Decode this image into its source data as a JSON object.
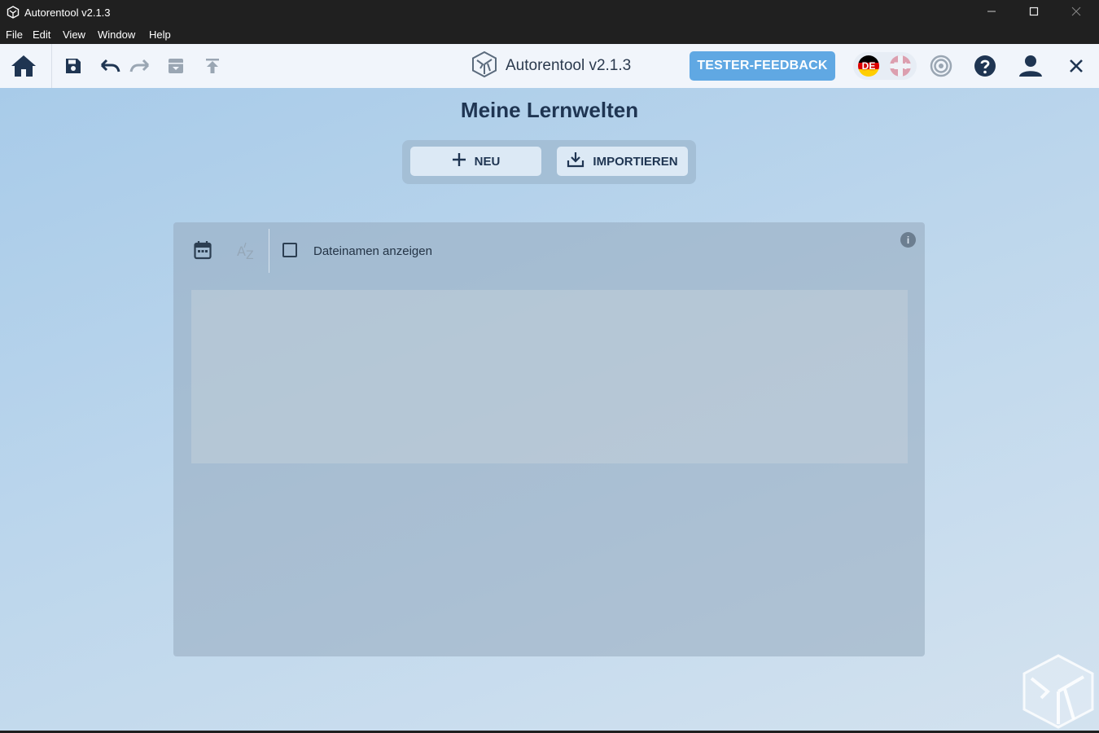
{
  "window": {
    "title": "Autorentool v2.1.3",
    "controls": [
      "minimize-icon",
      "maximize-icon",
      "close-icon"
    ]
  },
  "menu": {
    "items": [
      {
        "label": "File"
      },
      {
        "label": "Edit"
      },
      {
        "label": "View"
      },
      {
        "label": "Window"
      },
      {
        "label": "Help"
      }
    ]
  },
  "toolbar": {
    "left_icons": [
      "home-icon",
      "save-icon",
      "undo-icon",
      "redo-icon",
      "archive-icon",
      "upload-icon"
    ],
    "brand_name": "Autorentool v2.1.3",
    "feedback_label": "TESTER-FEEDBACK",
    "languages": [
      {
        "code": "DE",
        "active": true
      },
      {
        "code": "EN",
        "active": false
      }
    ],
    "right_icons": [
      "target-icon",
      "help-icon",
      "user-icon",
      "close-icon"
    ]
  },
  "main": {
    "heading": "Meine Lernwelten",
    "buttons": {
      "new_label": "NEU",
      "import_label": "IMPORTIEREN"
    },
    "panel": {
      "sort_icons": [
        "calendar-icon",
        "sort-az-icon"
      ],
      "checkbox_label": "Dateinamen anzeigen",
      "checkbox_checked": false,
      "info_icon": "info-icon"
    }
  },
  "colors": {
    "accent": "#60a8e3",
    "text_dark": "#1f3552",
    "titlebar": "#202020"
  }
}
